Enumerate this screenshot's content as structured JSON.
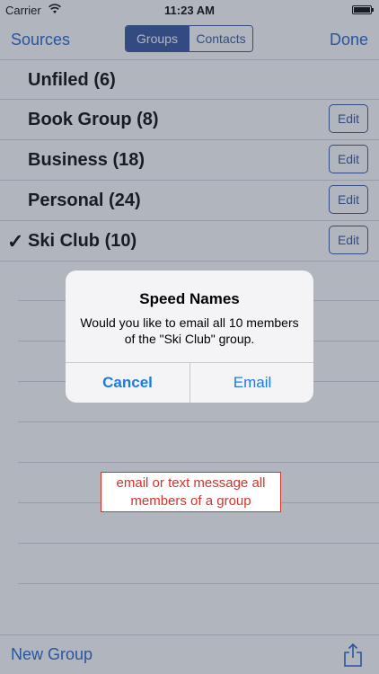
{
  "status_bar": {
    "carrier": "Carrier",
    "time": "11:23 AM"
  },
  "nav": {
    "left": "Sources",
    "segments": [
      "Groups",
      "Contacts"
    ],
    "active_segment": "Groups",
    "right": "Done"
  },
  "groups": [
    {
      "label": "Unfiled (6)",
      "checked": false,
      "editable": false
    },
    {
      "label": "Book Group (8)",
      "checked": false,
      "editable": true,
      "edit": "Edit"
    },
    {
      "label": "Business (18)",
      "checked": false,
      "editable": true,
      "edit": "Edit"
    },
    {
      "label": "Personal (24)",
      "checked": false,
      "editable": true,
      "edit": "Edit"
    },
    {
      "label": "Ski Club (10)",
      "checked": true,
      "check": "✓",
      "editable": true,
      "edit": "Edit"
    }
  ],
  "alert": {
    "title": "Speed Names",
    "message_line1": "Would you like to email all 10 members",
    "message_line2": "of the \"Ski Club\" group.",
    "cancel": "Cancel",
    "confirm": "Email"
  },
  "caption": {
    "line1": "email or text message all",
    "line2": "members of a group"
  },
  "toolbar": {
    "new_group": "New Group"
  },
  "colors": {
    "accent": "#1e5fcc",
    "segment": "#2f4f9c",
    "caption": "#d6322a",
    "alert_button": "#1a7be6"
  }
}
